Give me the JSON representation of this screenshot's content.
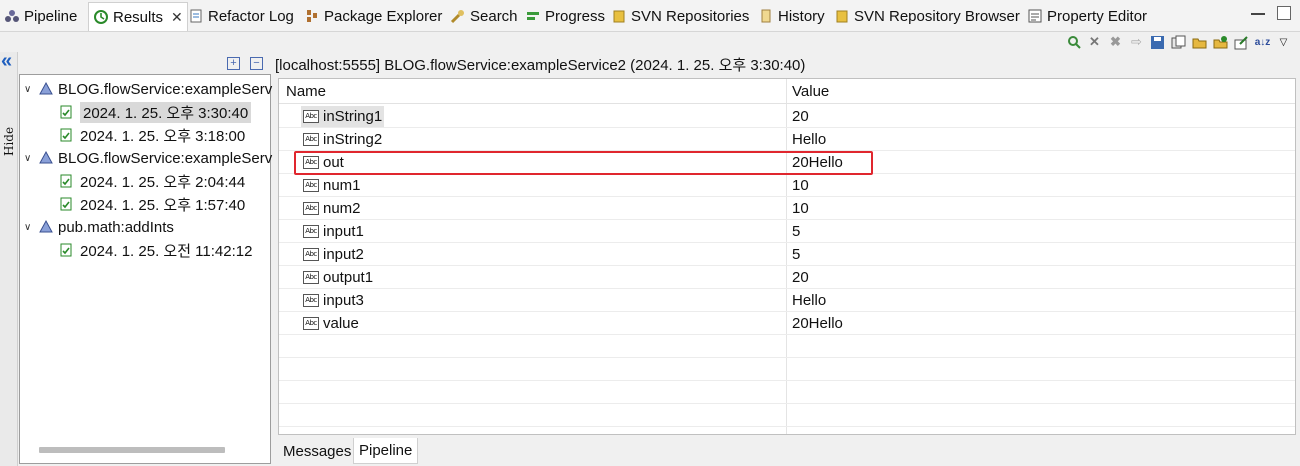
{
  "tabs": [
    {
      "label": "Pipeline",
      "icon": "pipeline-icon"
    },
    {
      "label": "Results",
      "icon": "results-icon",
      "active": true
    },
    {
      "label": "Refactor Log",
      "icon": "refactor-log-icon"
    },
    {
      "label": "Package Explorer",
      "icon": "package-explorer-icon"
    },
    {
      "label": "Search",
      "icon": "search-icon"
    },
    {
      "label": "Progress",
      "icon": "progress-icon"
    },
    {
      "label": "SVN Repositories",
      "icon": "svn-repositories-icon"
    },
    {
      "label": "History",
      "icon": "history-icon"
    },
    {
      "label": "SVN Repository Browser",
      "icon": "svn-repository-browser-icon"
    },
    {
      "label": "Property Editor",
      "icon": "property-editor-icon"
    }
  ],
  "sidebar": {
    "hide_label": "Hide",
    "tree": [
      {
        "label": "BLOG.flowService:exampleServ",
        "level": 0
      },
      {
        "label": "2024. 1. 25. 오후 3:30:40",
        "level": 1,
        "selected": true
      },
      {
        "label": "2024. 1. 25. 오후 3:18:00",
        "level": 1
      },
      {
        "label": "BLOG.flowService:exampleServ",
        "level": 0
      },
      {
        "label": "2024. 1. 25. 오후 2:04:44",
        "level": 1
      },
      {
        "label": "2024. 1. 25. 오후 1:57:40",
        "level": 1
      },
      {
        "label": "pub.math:addInts",
        "level": 0
      },
      {
        "label": "2024. 1. 25. 오전 11:42:12",
        "level": 1
      }
    ]
  },
  "main": {
    "path": "[localhost:5555]  BLOG.flowService:exampleService2 (2024. 1. 25. 오후 3:30:40)",
    "columns": {
      "name": "Name",
      "value": "Value"
    },
    "rows": [
      {
        "name": "inString1",
        "value": "20",
        "selected": true
      },
      {
        "name": "inString2",
        "value": "Hello"
      },
      {
        "name": "out",
        "value": "20Hello",
        "highlighted": true
      },
      {
        "name": "num1",
        "value": "10"
      },
      {
        "name": "num2",
        "value": "10"
      },
      {
        "name": "input1",
        "value": "5"
      },
      {
        "name": "input2",
        "value": "5"
      },
      {
        "name": "output1",
        "value": "20"
      },
      {
        "name": "input3",
        "value": "Hello"
      },
      {
        "name": "value",
        "value": "20Hello"
      }
    ],
    "type_badge": "Abc"
  },
  "bottom_tabs": [
    {
      "label": "Messages"
    },
    {
      "label": "Pipeline",
      "active": true
    }
  ],
  "colors": {
    "highlight": "#e0262e",
    "accent": "#1f5fbf"
  }
}
